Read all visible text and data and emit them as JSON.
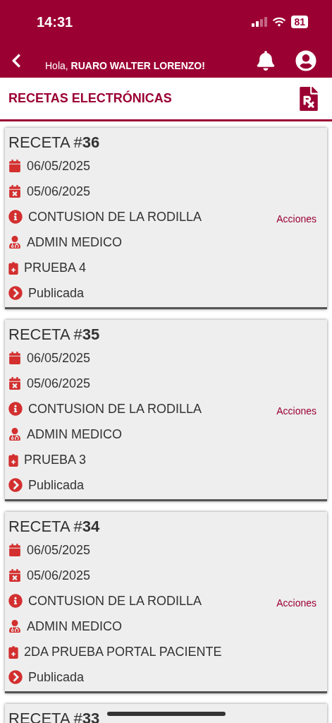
{
  "status_bar": {
    "time": "14:31",
    "battery": "81"
  },
  "header": {
    "greeting": "Hola, **RUARO WALTER LORENZO!**"
  },
  "section": {
    "title": "RECETAS ELECTRÓNICAS"
  },
  "recetas": [
    {
      "title": "RECETA #**36**",
      "action": "Acciones",
      "rows": [
        {
          "kind": "issued",
          "text": "06/05/2025"
        },
        {
          "kind": "expires",
          "text": "05/06/2025"
        },
        {
          "kind": "diagnosis",
          "text": "CONTUSION DE LA RODILLA"
        },
        {
          "kind": "doctor",
          "text": "ADMIN MEDICO"
        },
        {
          "kind": "product",
          "text": "PRUEBA 4"
        },
        {
          "kind": "status",
          "text": "Publicada"
        }
      ]
    },
    {
      "title": "RECETA #**35**",
      "action": "Acciones",
      "rows": [
        {
          "kind": "issued",
          "text": "06/05/2025"
        },
        {
          "kind": "expires",
          "text": "05/06/2025"
        },
        {
          "kind": "diagnosis",
          "text": "CONTUSION DE LA RODILLA"
        },
        {
          "kind": "doctor",
          "text": "ADMIN MEDICO"
        },
        {
          "kind": "product",
          "text": "PRUEBA 3"
        },
        {
          "kind": "status",
          "text": "Publicada"
        }
      ]
    },
    {
      "title": "RECETA #**34**",
      "action": "Acciones",
      "rows": [
        {
          "kind": "issued",
          "text": "06/05/2025"
        },
        {
          "kind": "expires",
          "text": "05/06/2025"
        },
        {
          "kind": "diagnosis",
          "text": "CONTUSION DE LA RODILLA"
        },
        {
          "kind": "doctor",
          "text": "ADMIN MEDICO"
        },
        {
          "kind": "product",
          "text": "2DA PRUEBA PORTAL PACIENTE"
        },
        {
          "kind": "status",
          "text": "Publicada"
        }
      ]
    },
    {
      "title": "RECETA #**33**"
    }
  ]
}
